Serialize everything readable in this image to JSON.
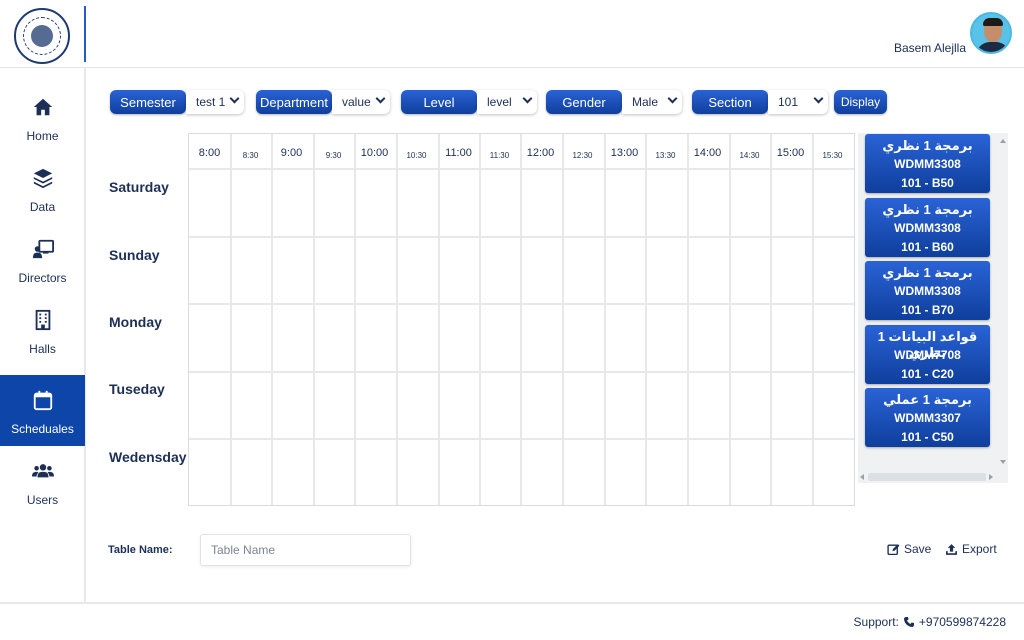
{
  "header": {
    "user_name": "Basem Alejlla"
  },
  "sidebar": {
    "items": [
      {
        "label": "Home",
        "icon": "home-icon",
        "active": false
      },
      {
        "label": "Data",
        "icon": "layers-icon",
        "active": false
      },
      {
        "label": "Directors",
        "icon": "chalkboard-teacher-icon",
        "active": false
      },
      {
        "label": "Halls",
        "icon": "building-icon",
        "active": false
      },
      {
        "label": "Scheduales",
        "icon": "calendar-icon",
        "active": true
      },
      {
        "label": "Users",
        "icon": "users-icon",
        "active": false
      }
    ]
  },
  "filters": {
    "semester": {
      "label": "Semester",
      "value": "test 1"
    },
    "department": {
      "label": "Department",
      "value": "value"
    },
    "level": {
      "label": "Level",
      "value": "level"
    },
    "gender": {
      "label": "Gender",
      "value": "Male"
    },
    "section": {
      "label": "Section",
      "value": "101"
    },
    "display_label": "Display"
  },
  "timetable": {
    "times": [
      "8:00",
      "8:30",
      "9:00",
      "9:30",
      "10:00",
      "10:30",
      "11:00",
      "11:30",
      "12:00",
      "12:30",
      "13:00",
      "13:30",
      "14:00",
      "14:30",
      "15:00",
      "15:30"
    ],
    "days": [
      "Saturday",
      "Sunday",
      "Monday",
      "Tuseday",
      "Wedensday"
    ]
  },
  "courses": [
    {
      "name": "برمجة 1 نظري",
      "code": "WDMM3308",
      "room": "101 - B50"
    },
    {
      "name": "برمجة 1 نظري",
      "code": "WDMM3308",
      "room": "101 - B60"
    },
    {
      "name": "برمجة 1 نظري",
      "code": "WDMM3308",
      "room": "101 - B70"
    },
    {
      "name": "قواعد البيانات 1 نظري",
      "code": "WDMM7708",
      "room": "101 - C20"
    },
    {
      "name": "برمجة 1 عملي",
      "code": "WDMM3307",
      "room": "101 - C50"
    }
  ],
  "table_name": {
    "label": "Table Name:",
    "placeholder": "Table Name",
    "value": ""
  },
  "actions": {
    "save_label": "Save",
    "export_label": "Export"
  },
  "footer": {
    "support_label": "Support:",
    "phone": "+970599874228"
  },
  "colors": {
    "accent": "#0d46a8",
    "text": "#1c2f55"
  }
}
